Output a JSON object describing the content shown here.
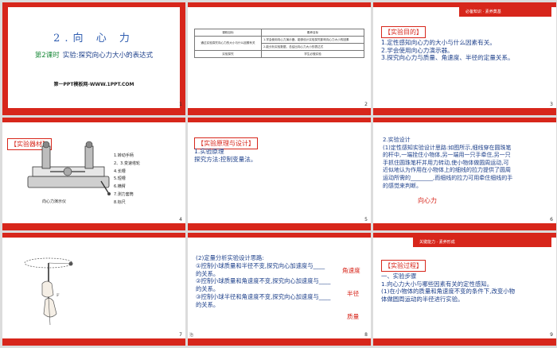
{
  "slides": [
    {
      "number": "1",
      "title": "2.向 心 力",
      "subtitle_highlight": "第2课时",
      "subtitle_text": "实验:探究向心力大小的表达式",
      "website": "第一PPT模板网-WWW.1PPT.COM"
    },
    {
      "number": "2",
      "table": {
        "headers": [
          "课程目标",
          "素养目标"
        ],
        "rows": [
          [
            "通过实验探究向心力的大小与什么因素有关",
            "1.学会使用向心力演示器，能够设计实验探究影响向心力大小的因素"
          ],
          [
            "",
            "2.能分析实验数据，总结出向心力大小的表达式"
          ],
          [
            "实验探究",
            "学生必做实验"
          ]
        ]
      }
    },
    {
      "number": "3",
      "ribbon": "必备知识 · 素养奠基",
      "heading": "【实验目的】",
      "lines": [
        "1.定性感知向心力的大小与什么因素有关。",
        "2.学会使用向心力演示器。",
        "3.探究向心力与质量、角速度、半径的定量关系。"
      ]
    },
    {
      "number": "4",
      "heading": "【实验器材】",
      "legend": [
        "1.转动手柄",
        "2、3.变速塔轮",
        "4.长槽",
        "5.短槽",
        "6.横臂",
        "7.测力套筒",
        "8.标尺"
      ],
      "caption": "向心力演示仪"
    },
    {
      "number": "5",
      "heading": "【实验原理与设计】",
      "lines": [
        "1.实验原理",
        "探究方法:控制变量法。"
      ]
    },
    {
      "number": "6",
      "lines": [
        "2.实验设计",
        "(1)定性感知实验设计思路:如图所示,细线穿在圆珠笔",
        "的杆中,一端拴住小物体,另一端用一只手牵住,另一只",
        "手抓住圆珠笔杆并用力转动,使小物体做圆周运动,可",
        "近似地认为作用在小物体上的细线的拉力提供了圆周",
        "运动所需的________,而细线的拉力可用牵住细线的手",
        "的感觉来判断。"
      ],
      "answer": "向心力"
    },
    {
      "number": "7"
    },
    {
      "number": "8",
      "lines": [
        "(2)定量分析实验设计思路:",
        "①控制小球质量和半径不变,探究向心加速度与____",
        "的关系。",
        "②控制小球质量和角速度不变,探究向心加速度与____",
        "的关系。",
        "③控制小球半径和角速度不变,探究向心加速度与____",
        "的关系。"
      ],
      "answers": [
        "角速度",
        "半径",
        "质量"
      ]
    },
    {
      "number": "9",
      "ribbon": "关键能力 · 素养形成",
      "heading": "【实验过程】",
      "lines": [
        "一、实验步骤",
        "1.向心力大小与哪些因素有关的定性感知。",
        "(1)在小物体的质量和角速度不变的条件下,改变小物",
        "体做圆周运动的半径进行实验。"
      ]
    }
  ],
  "colors": {
    "accent": "#d7261b",
    "text_blue": "#1c3f8a",
    "title_blue": "#2f5db0",
    "highlight_green": "#1b8a3a"
  },
  "footer_mark": "治"
}
